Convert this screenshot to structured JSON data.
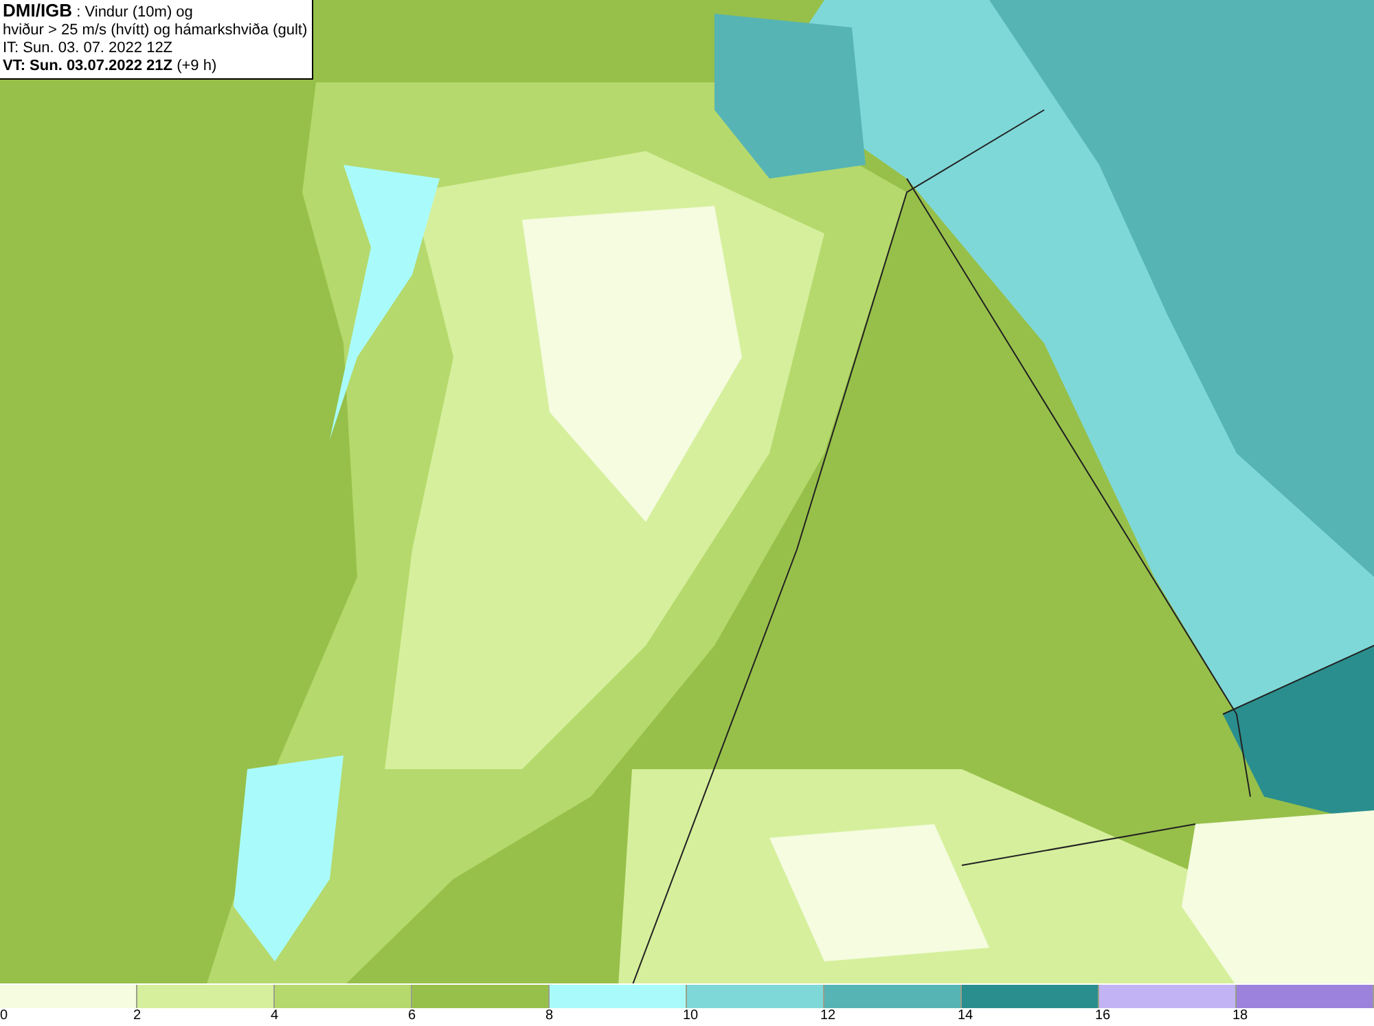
{
  "header": {
    "title": "**DMI/IGB** : Vindur (10m) og",
    "subtitle": "hviður > 25 m/s (hvítt) og hámarkshviða (gult)",
    "issue_time": "IT: Sun. 03. 07. 2022 12Z",
    "valid_time": "**VT: Sun. 03.07.2022 21Z** (+9 h)"
  },
  "legend": [
    {
      "color": "#f5fce0",
      "label": "0"
    },
    {
      "color": "#d6ef9c",
      "label": "2"
    },
    {
      "color": "#b5d96c",
      "label": "4"
    },
    {
      "color": "#97c04a",
      "label": "6"
    },
    {
      "color": "#a9fbfb",
      "label": "8"
    },
    {
      "color": "#7fd8d8",
      "label": "10"
    },
    {
      "color": "#56b4b4",
      "label": "12"
    },
    {
      "color": "#2a8e8e",
      "label": "14"
    },
    {
      "color": "#c2b3f5",
      "label": "16"
    },
    {
      "color": "#9c82dc",
      "label": "18"
    }
  ]
}
